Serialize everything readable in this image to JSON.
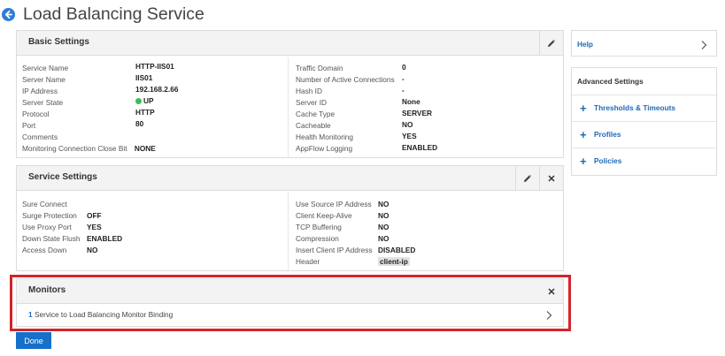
{
  "page": {
    "title": "Load Balancing Service"
  },
  "basic_settings": {
    "title": "Basic Settings",
    "left": [
      {
        "label": "Service Name",
        "value": "HTTP-IIS01"
      },
      {
        "label": "Server Name",
        "value": "IIS01"
      },
      {
        "label": "IP Address",
        "value": "192.168.2.66"
      },
      {
        "label": "Server State",
        "value": "UP"
      },
      {
        "label": "Protocol",
        "value": "HTTP"
      },
      {
        "label": "Port",
        "value": "80"
      },
      {
        "label": "Comments",
        "value": ""
      },
      {
        "label": "Monitoring Connection Close Bit",
        "value": "NONE"
      }
    ],
    "right": [
      {
        "label": "Traffic Domain",
        "value": "0"
      },
      {
        "label": "Number of Active Connections",
        "value": "-"
      },
      {
        "label": "Hash ID",
        "value": "-"
      },
      {
        "label": "Server ID",
        "value": "None"
      },
      {
        "label": "Cache Type",
        "value": "SERVER"
      },
      {
        "label": "Cacheable",
        "value": "NO"
      },
      {
        "label": "Health Monitoring",
        "value": "YES"
      },
      {
        "label": "AppFlow Logging",
        "value": "ENABLED"
      }
    ]
  },
  "service_settings": {
    "title": "Service Settings",
    "left": [
      {
        "label": "Sure Connect",
        "value": ""
      },
      {
        "label": "Surge Protection",
        "value": "OFF"
      },
      {
        "label": "Use Proxy Port",
        "value": "YES"
      },
      {
        "label": "Down State Flush",
        "value": "ENABLED"
      },
      {
        "label": "Access Down",
        "value": "NO"
      }
    ],
    "right": [
      {
        "label": "Use Source IP Address",
        "value": "NO"
      },
      {
        "label": "Client Keep-Alive",
        "value": "NO"
      },
      {
        "label": "TCP Buffering",
        "value": "NO"
      },
      {
        "label": "Compression",
        "value": "NO"
      },
      {
        "label": "Insert Client IP Address",
        "value": "DISABLED"
      },
      {
        "label": "Header",
        "value": "client-ip"
      }
    ]
  },
  "monitors": {
    "title": "Monitors",
    "binding_count": "1",
    "binding_label": "Service to Load Balancing Monitor Binding"
  },
  "sidebar": {
    "help_label": "Help",
    "advanced_title": "Advanced Settings",
    "items": [
      "Thresholds & Timeouts",
      "Profiles",
      "Policies"
    ]
  },
  "actions": {
    "done_label": "Done"
  },
  "colors": {
    "accent": "#1670c9",
    "link": "#1e6ab8",
    "highlight_border": "#d4232a",
    "status_up": "#3dbd5b"
  },
  "icons": {
    "back": "back-arrow-icon",
    "edit": "pencil-icon",
    "close": "close-icon",
    "chevron": "chevron-right-icon",
    "plus": "plus-icon",
    "status": "status-dot-icon"
  }
}
